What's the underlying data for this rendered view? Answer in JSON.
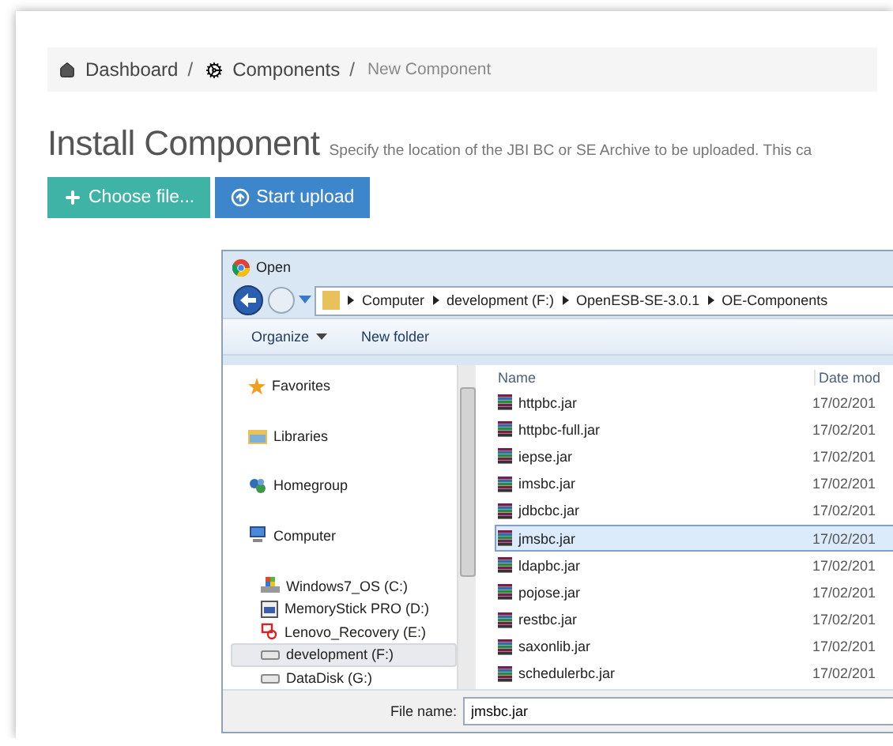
{
  "breadcrumb": [
    {
      "label": "Dashboard",
      "separator": "/",
      "current": false
    },
    {
      "label": "Components",
      "separator": "/",
      "current": false
    },
    {
      "label": "New Component",
      "current": true
    }
  ],
  "heading": {
    "title": "Install Component",
    "subtitle": "Specify the location of the JBI BC or SE Archive to be uploaded. This ca"
  },
  "buttons": [
    {
      "label": "Choose file...",
      "kind": "choose"
    },
    {
      "label": "Start upload",
      "kind": "upload"
    }
  ],
  "dialog": {
    "title": "Open",
    "path": [
      "Computer",
      "development (F:)",
      "OpenESB-SE-3.0.1",
      "OE-Components"
    ],
    "toolbar": [
      {
        "label": "Organize",
        "dropdown": true
      },
      {
        "label": "New folder",
        "dropdown": false
      }
    ],
    "nav": [
      {
        "label": "Favorites",
        "kind": "favorites",
        "selected": false
      },
      {
        "label": "Libraries",
        "kind": "libraries",
        "selected": false
      },
      {
        "label": "Homegroup",
        "kind": "homegroup",
        "selected": false
      },
      {
        "label": "Computer",
        "kind": "computer",
        "selected": false,
        "children": [
          {
            "label": "Windows7_OS (C:)",
            "kind": "os",
            "selected": false
          },
          {
            "label": "MemoryStick PRO (D:)",
            "kind": "card",
            "selected": false
          },
          {
            "label": "Lenovo_Recovery (E:)",
            "kind": "recovery",
            "selected": false
          },
          {
            "label": "development (F:)",
            "kind": "drive",
            "selected": true
          },
          {
            "label": "DataDisk (G:)",
            "kind": "drive",
            "selected": false
          }
        ]
      }
    ],
    "columns": [
      "Name",
      "Date mod"
    ],
    "files": [
      {
        "name": "httpbc.jar",
        "date": "17/02/201",
        "selected": false
      },
      {
        "name": "httpbc-full.jar",
        "date": "17/02/201",
        "selected": false
      },
      {
        "name": "iepse.jar",
        "date": "17/02/201",
        "selected": false
      },
      {
        "name": "imsbc.jar",
        "date": "17/02/201",
        "selected": false
      },
      {
        "name": "jdbcbc.jar",
        "date": "17/02/201",
        "selected": false
      },
      {
        "name": "jmsbc.jar",
        "date": "17/02/201",
        "selected": true
      },
      {
        "name": "ldapbc.jar",
        "date": "17/02/201",
        "selected": false
      },
      {
        "name": "pojose.jar",
        "date": "17/02/201",
        "selected": false
      },
      {
        "name": "restbc.jar",
        "date": "17/02/201",
        "selected": false
      },
      {
        "name": "saxonlib.jar",
        "date": "17/02/201",
        "selected": false
      },
      {
        "name": "schedulerbc.jar",
        "date": "17/02/201",
        "selected": false
      }
    ],
    "file_name": {
      "label": "File name:",
      "value": "jmsbc.jar"
    }
  }
}
